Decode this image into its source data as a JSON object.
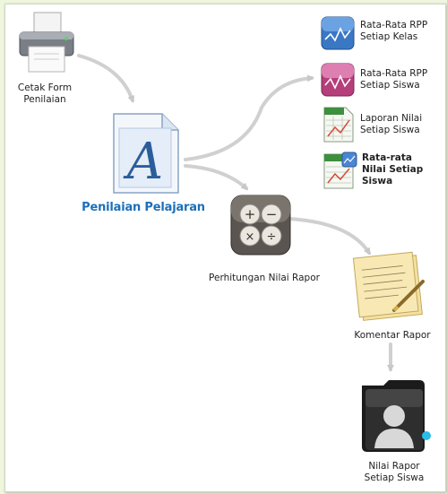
{
  "nodes": {
    "cetak_form": {
      "line1": "Cetak Form",
      "line2": "Penilaian",
      "icon": "printer-icon"
    },
    "penilaian_pelajaran": {
      "label": "Penilaian Pelajaran",
      "icon": "document-font-icon"
    },
    "rata_kelas": {
      "line1": "Rata-Rata RPP",
      "line2": "Setiap Kelas",
      "icon": "blue-chart-icon"
    },
    "rata_siswa": {
      "line1": "Rata-Rata RPP",
      "line2": "Setiap Siswa",
      "icon": "pink-chart-icon"
    },
    "laporan_nilai": {
      "line1": "Laporan Nilai",
      "line2": "Setiap Siswa",
      "icon": "spreadsheet-icon"
    },
    "rata_nilai": {
      "line1": "Rata-rata",
      "line2": "Nilai Setiap",
      "line3": "Siswa",
      "icon": "spreadsheet-chart-icon"
    },
    "perhitungan": {
      "label": "Perhitungan Nilai Rapor",
      "icon": "calculator-icon"
    },
    "komentar": {
      "label": "Komentar Rapor",
      "icon": "notepad-icon"
    },
    "nilai_rapor": {
      "line1": "Nilai Rapor",
      "line2": "Setiap Siswa",
      "icon": "user-folder-icon"
    }
  },
  "colors": {
    "accent": "#1d6fb8",
    "arrow": "#cfcfcf",
    "background": "#eef6dd"
  }
}
